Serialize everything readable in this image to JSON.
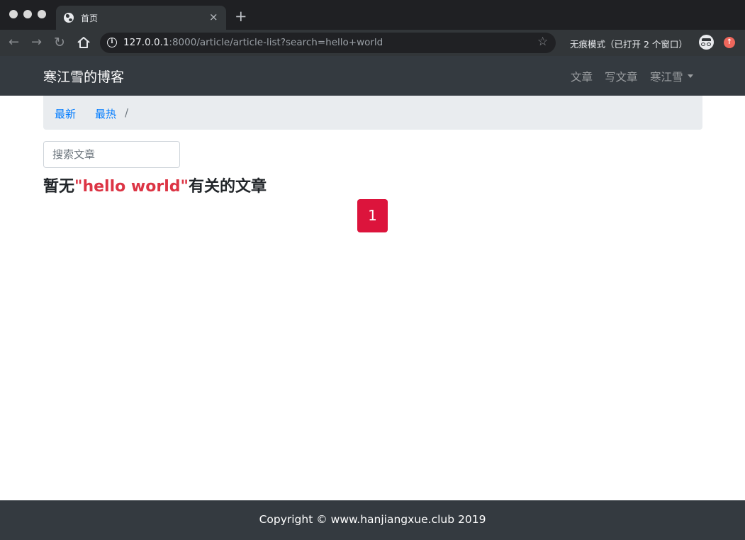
{
  "browser": {
    "tab_title": "首页",
    "tab_close": "×",
    "new_tab": "+",
    "url_host": "127.0.0.1",
    "url_rest": ":8000/article/article-list?search=hello+world",
    "incognito_text": "无痕模式（已打开 2 个窗口）",
    "icons": [
      "back-icon",
      "forward-icon",
      "reload-icon",
      "home-icon",
      "info-icon",
      "star-icon",
      "incognito-icon",
      "update-icon"
    ]
  },
  "navbar": {
    "brand": "寒江雪的博客",
    "links": [
      "文章",
      "写文章",
      "寒江雪"
    ]
  },
  "breadcrumb": {
    "items": [
      "最新",
      "最热"
    ],
    "separator": "/"
  },
  "search": {
    "placeholder": "搜索文章",
    "value": ""
  },
  "result": {
    "prefix": "暂无",
    "query": "\"hello world\"",
    "suffix": "有关的文章"
  },
  "pagination": {
    "current_page": "1"
  },
  "footer": {
    "text": "Copyright © www.hanjiangxue.club 2019"
  },
  "colors": {
    "navbar_bg": "#343a40",
    "link": "#007bff",
    "highlight": "#dc3545",
    "page_button": "#dc143c"
  }
}
